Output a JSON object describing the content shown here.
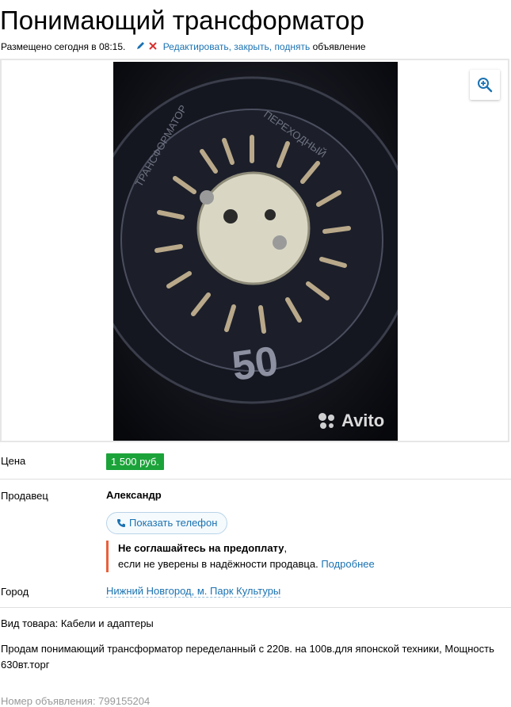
{
  "listing": {
    "title": "Понимающий трансформатор",
    "posted": "Размещено сегодня в 08:15.",
    "actions": {
      "edit": "Редактировать",
      "sep1": ", ",
      "close": "закрыть",
      "sep2": ", ",
      "raise": "поднять",
      "suffix": " объявление"
    },
    "photo_watermark": "Avito",
    "price_label": "Цена",
    "price": "1 500 руб.",
    "seller_label": "Продавец",
    "seller_name": "Александр",
    "phone_button": "Показать телефон",
    "warning_bold": "Не соглашайтесь на предоплату",
    "warning_comma": ",",
    "warning_text": "если не уверены в надёжности продавца. ",
    "warning_link": "Подробнее",
    "city_label": "Город",
    "city": "Нижний Новгород, м. Парк Культуры",
    "kind": "Вид товара: Кабели и адаптеры",
    "description": "Продам понимающий трансформатор переделанный с 220в. на 100в.для японской техники, Мощность 630вт.торг",
    "ad_number": "Номер объявления: 799155204"
  },
  "colors": {
    "accent": "#1a72b2",
    "price": "#1ba339",
    "warning": "#e8603c"
  },
  "icons": [
    "pencil-icon",
    "delete-icon",
    "zoom-in-icon",
    "phone-icon",
    "avito-logo"
  ]
}
